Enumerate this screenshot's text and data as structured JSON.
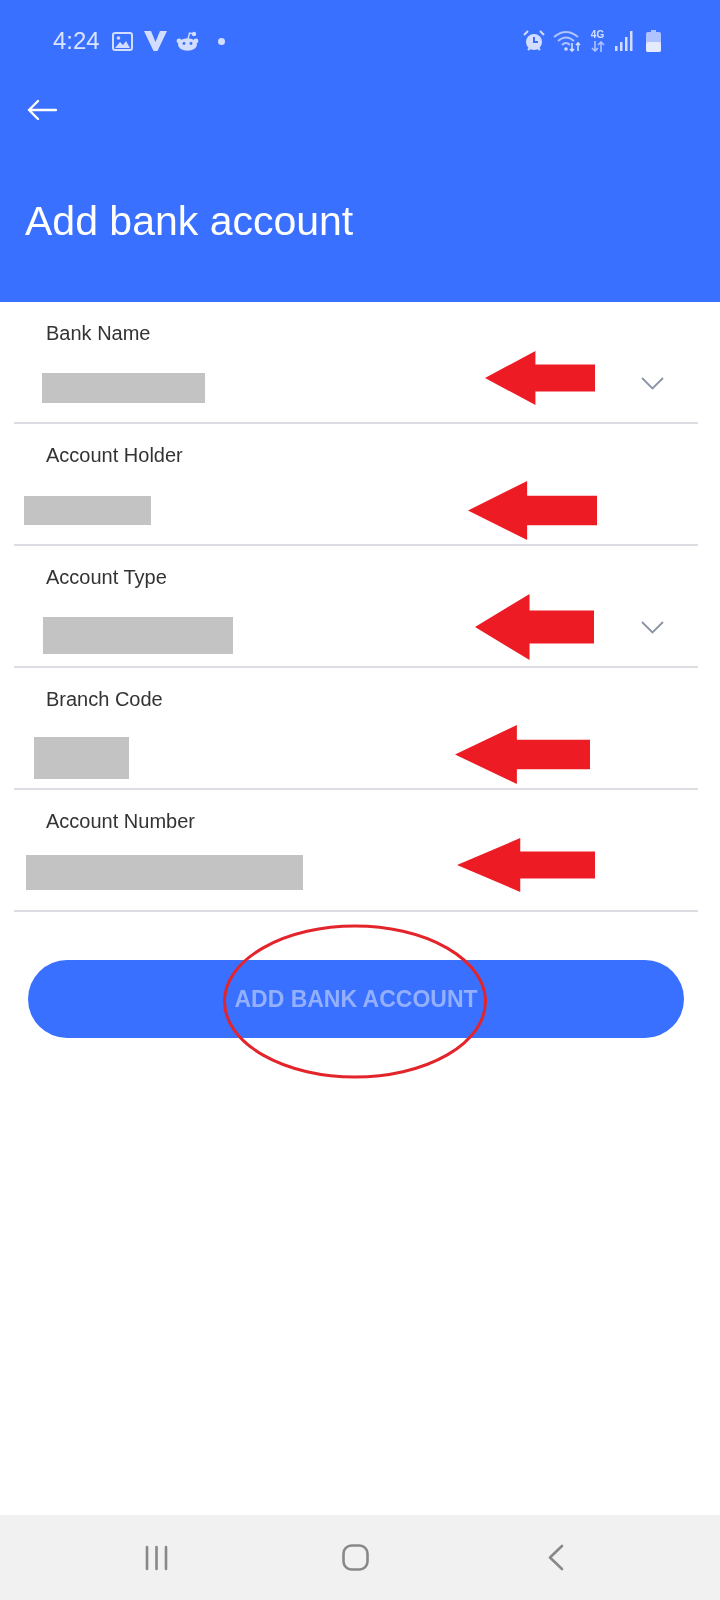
{
  "status_bar": {
    "time": "4:24",
    "network_type": "4G"
  },
  "app_bar": {
    "title": "Add bank account"
  },
  "form": {
    "fields": [
      {
        "label": "Bank Name",
        "kind": "dropdown",
        "redacted": true,
        "arrow_marked": true
      },
      {
        "label": "Account Holder",
        "kind": "text",
        "redacted": true,
        "arrow_marked": true
      },
      {
        "label": "Account Type",
        "kind": "dropdown",
        "redacted": true,
        "arrow_marked": true
      },
      {
        "label": "Branch Code",
        "kind": "text",
        "redacted": true,
        "arrow_marked": true
      },
      {
        "label": "Account Number",
        "kind": "text",
        "redacted": true,
        "arrow_marked": true
      }
    ]
  },
  "submit_button": {
    "label": "ADD BANK ACCOUNT",
    "disabled": true,
    "circled": true
  }
}
